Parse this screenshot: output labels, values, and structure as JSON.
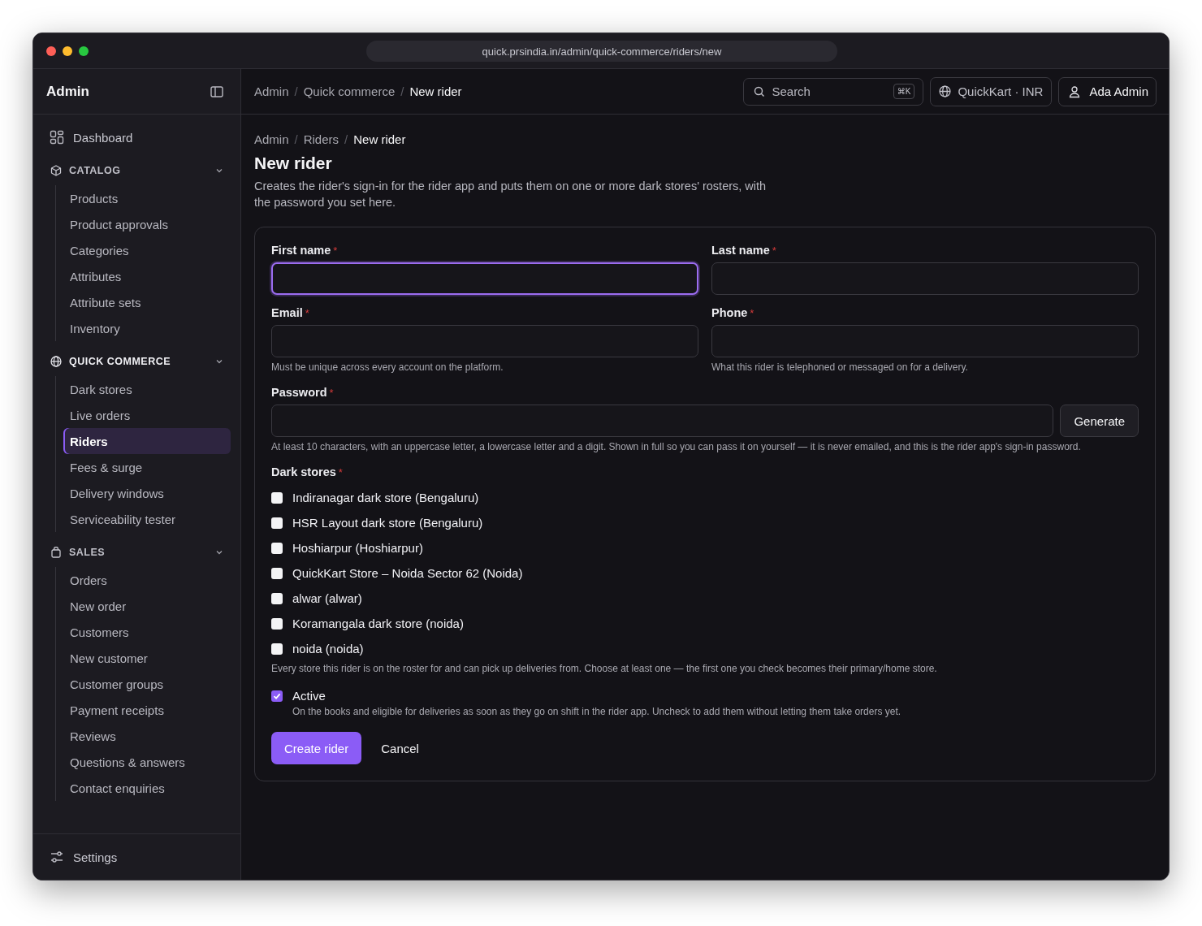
{
  "browser": {
    "url": "quick.prsindia.in/admin/quick-commerce/riders/new"
  },
  "sidebar": {
    "title": "Admin",
    "dashboard": {
      "label": "Dashboard",
      "selected": false
    },
    "sections": [
      {
        "title": "CATALOG",
        "expanded": true,
        "items": [
          {
            "label": "Products",
            "selected": false
          },
          {
            "label": "Product approvals",
            "selected": false
          },
          {
            "label": "Categories",
            "selected": false
          },
          {
            "label": "Attributes",
            "selected": false
          },
          {
            "label": "Attribute sets",
            "selected": false
          },
          {
            "label": "Inventory",
            "selected": false
          }
        ]
      },
      {
        "title": "QUICK COMMERCE",
        "expanded": true,
        "items": [
          {
            "label": "Dark stores",
            "selected": false
          },
          {
            "label": "Live orders",
            "selected": false
          },
          {
            "label": "Riders",
            "selected": true
          },
          {
            "label": "Fees & surge",
            "selected": false
          },
          {
            "label": "Delivery windows",
            "selected": false
          },
          {
            "label": "Serviceability tester",
            "selected": false
          }
        ]
      },
      {
        "title": "SALES",
        "expanded": true,
        "items": [
          {
            "label": "Orders",
            "selected": false
          },
          {
            "label": "New order",
            "selected": false
          },
          {
            "label": "Customers",
            "selected": false
          },
          {
            "label": "New customer",
            "selected": false
          },
          {
            "label": "Customer groups",
            "selected": false
          },
          {
            "label": "Payment receipts",
            "selected": false
          },
          {
            "label": "Reviews",
            "selected": false
          },
          {
            "label": "Questions & answers",
            "selected": false
          },
          {
            "label": "Contact enquiries",
            "selected": false
          }
        ]
      }
    ],
    "settings": {
      "label": "Settings"
    }
  },
  "header": {
    "breadcrumb": [
      "Admin",
      "Quick commerce",
      "New rider"
    ],
    "breadcrumb_separators": [
      "/",
      "/"
    ],
    "search": {
      "placeholder": "Search",
      "shortcut": "⌘K"
    },
    "store": "QuickKart · INR",
    "user": "Ada Admin"
  },
  "page": {
    "breadcrumb": [
      "Admin",
      "Riders",
      "New rider"
    ],
    "breadcrumb_separators": [
      "/",
      "/"
    ],
    "title": "New rider",
    "description": "Creates the rider's sign-in for the rider app and puts them on one or more dark stores' rosters, with the password you set here."
  },
  "form": {
    "fields": [
      {
        "label": "First name",
        "required_mark": "*",
        "focused": true
      },
      {
        "label": "Last name",
        "required_mark": "*",
        "focused": false
      },
      {
        "label": "Email",
        "required_mark": "*",
        "focused": false,
        "help": "Must be unique across every account on the platform."
      },
      {
        "label": "Phone",
        "required_mark": "*",
        "focused": false,
        "help": "What this rider is telephoned or messaged on for a delivery."
      }
    ],
    "password": {
      "label": "Password",
      "required_mark": "*",
      "button": "Generate",
      "help": "At least 10 characters, with an uppercase letter, a lowercase letter and a digit. Shown in full so you can pass it on yourself — it is never emailed, and this is the rider app's sign-in password."
    },
    "dark_stores": {
      "label": "Dark stores",
      "required_mark": "*",
      "options": [
        {
          "label": "Indiranagar dark store (Bengaluru)",
          "checked": false
        },
        {
          "label": "HSR Layout dark store (Bengaluru)",
          "checked": false
        },
        {
          "label": "Hoshiarpur (Hoshiarpur)",
          "checked": false
        },
        {
          "label": "QuickKart Store – Noida Sector 62 (Noida)",
          "checked": false
        },
        {
          "label": "alwar (alwar)",
          "checked": false
        },
        {
          "label": "Koramangala dark store (noida)",
          "checked": false
        },
        {
          "label": "noida (noida)",
          "checked": false
        }
      ],
      "help": "Every store this rider is on the roster for and can pick up deliveries from. Choose at least one — the first one you check becomes their primary/home store."
    },
    "active": {
      "label": "Active",
      "checked": true,
      "help": "On the books and eligible for deliveries as soon as they go on shift in the rider app. Uncheck to add them without letting them take orders yet."
    },
    "actions": {
      "submit": "Create rider",
      "cancel": "Cancel"
    }
  }
}
